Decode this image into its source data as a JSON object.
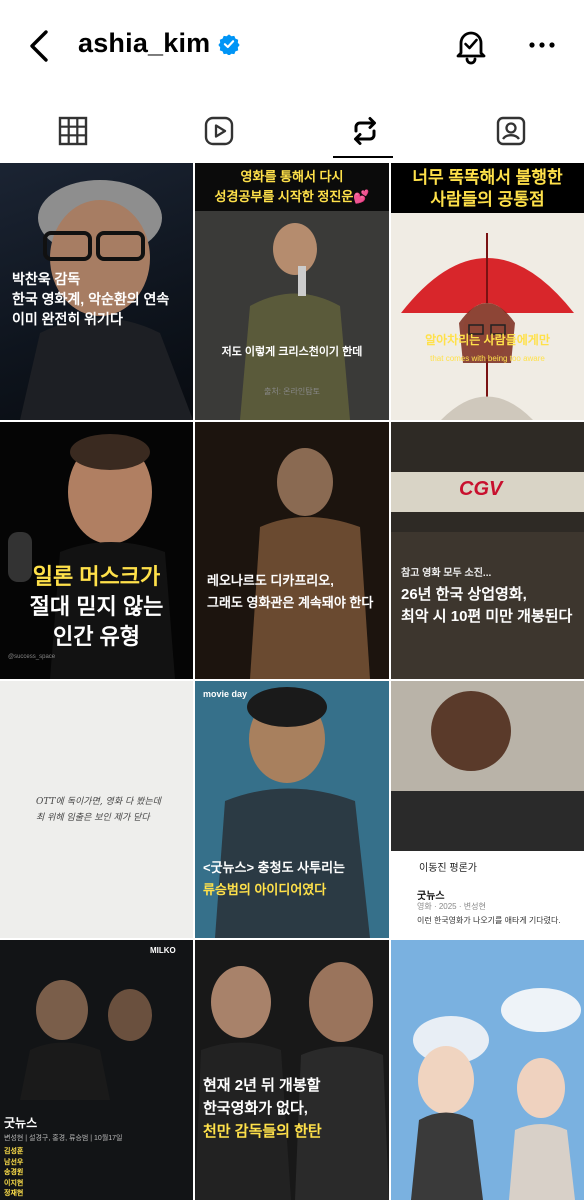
{
  "header": {
    "username": "ashia_kim",
    "back_icon": "chevron-left-icon",
    "verified_icon": "verified-badge-icon",
    "bell_icon": "bell-icon",
    "more_icon": "more-horizontal-icon",
    "verified_color": "#0095f6"
  },
  "tabs": [
    {
      "id": "grid",
      "icon": "grid-icon"
    },
    {
      "id": "reels",
      "icon": "reels-icon"
    },
    {
      "id": "reposts",
      "icon": "repost-icon",
      "active": true
    },
    {
      "id": "tagged",
      "icon": "tagged-icon"
    }
  ],
  "posts": [
    {
      "lines": [
        "박찬욱 감독",
        "한국 영화계, 악순환의 연속",
        "이미 완전히 위기다"
      ]
    },
    {
      "top1": "영화를 통해서 다시",
      "top2": "성경공부를 시작한 정진운💕",
      "caption": "저도 이렇게 크리스천이기 한데",
      "credit": "출처: 온라인탐토"
    },
    {
      "top1": "너무 똑똑해서 불행한",
      "top2": "사람들의 공통점",
      "sub": "알아차리는 사람들에게만",
      "sub_en": "that comes with being too aware"
    },
    {
      "lines": [
        "일론 머스크가",
        "절대 믿지 않는",
        "인간 유형"
      ],
      "credit": "@success_space"
    },
    {
      "lines": [
        "레오나르도 디카프리오,",
        "그래도 영화관은 계속돼야 한다"
      ]
    },
    {
      "tag": "참고 영화 모두 소진...",
      "lines": [
        "26년 한국 상업영화,",
        "최악 시 10편 미만 개봉된다"
      ],
      "marquee": "CGV"
    },
    {
      "handwriting1": "OTT에 독이가면, 영화 다 봤는데",
      "handwriting2": "최 위헤 임출은 보인 제가 닫다"
    },
    {
      "brand": "movie day",
      "lines": [
        "<굿뉴스> 충청도 사투리는",
        "류승범의 아이디어였다"
      ]
    },
    {
      "reviewer": "이동진 평론가",
      "review_title": "굿뉴스",
      "review_meta": "영화 · 2025 · 변성현",
      "review_text": "이런 한국영화가 나오기를 애타게 기다렸다."
    },
    {
      "brand": "MILKO",
      "title": "굿뉴스",
      "meta": "변성현 | 설경구, 홍경, 류승범 | 10월17일",
      "critics": [
        "김성훈",
        "남선우",
        "송경원",
        "이지현",
        "정재현"
      ]
    },
    {
      "lines": [
        "현재 2년 뒤 개봉할",
        "한국영화가 없다,",
        "천만 감독들의 한탄"
      ]
    },
    {
      "kind": "photo"
    }
  ]
}
